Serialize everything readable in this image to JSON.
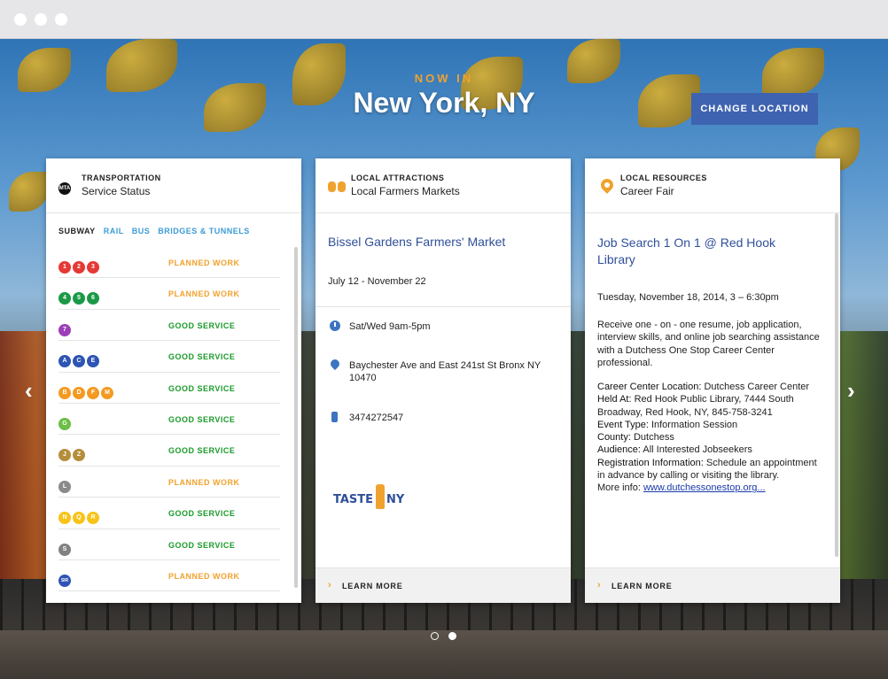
{
  "hero": {
    "now_in": "NOW IN",
    "city": "New York, NY",
    "change_location": "CHANGE LOCATION"
  },
  "transport": {
    "kicker": "TRANSPORTATION",
    "title": "Service Status",
    "icon": "mta-logo-icon",
    "icon_text": "MTA",
    "tabs": [
      "SUBWAY",
      "RAIL",
      "BUS",
      "BRIDGES & TUNNELS"
    ],
    "lines": [
      {
        "bullets": [
          {
            "label": "1",
            "color": "#e53935"
          },
          {
            "label": "2",
            "color": "#e53935"
          },
          {
            "label": "3",
            "color": "#e53935"
          }
        ],
        "status": "PLANNED WORK",
        "status_color": "#f0a22e"
      },
      {
        "bullets": [
          {
            "label": "4",
            "color": "#1a9a47"
          },
          {
            "label": "5",
            "color": "#1a9a47"
          },
          {
            "label": "6",
            "color": "#1a9a47"
          }
        ],
        "status": "PLANNED WORK",
        "status_color": "#f0a22e"
      },
      {
        "bullets": [
          {
            "label": "7",
            "color": "#9c3fb8"
          }
        ],
        "status": "GOOD SERVICE",
        "status_color": "#1a9a2a"
      },
      {
        "bullets": [
          {
            "label": "A",
            "color": "#2e55b5"
          },
          {
            "label": "C",
            "color": "#2e55b5"
          },
          {
            "label": "E",
            "color": "#2e55b5"
          }
        ],
        "status": "GOOD SERVICE",
        "status_color": "#1a9a2a"
      },
      {
        "bullets": [
          {
            "label": "B",
            "color": "#f49a21"
          },
          {
            "label": "D",
            "color": "#f49a21"
          },
          {
            "label": "F",
            "color": "#f49a21"
          },
          {
            "label": "M",
            "color": "#f49a21"
          }
        ],
        "status": "GOOD SERVICE",
        "status_color": "#1a9a2a"
      },
      {
        "bullets": [
          {
            "label": "G",
            "color": "#6cbe45"
          }
        ],
        "status": "GOOD SERVICE",
        "status_color": "#1a9a2a"
      },
      {
        "bullets": [
          {
            "label": "J",
            "color": "#b58d3c"
          },
          {
            "label": "Z",
            "color": "#b58d3c"
          }
        ],
        "status": "GOOD SERVICE",
        "status_color": "#1a9a2a"
      },
      {
        "bullets": [
          {
            "label": "L",
            "color": "#8a8a8a"
          }
        ],
        "status": "PLANNED WORK",
        "status_color": "#f0a22e"
      },
      {
        "bullets": [
          {
            "label": "N",
            "color": "#f8c318"
          },
          {
            "label": "Q",
            "color": "#f8c318"
          },
          {
            "label": "R",
            "color": "#f8c318"
          }
        ],
        "status": "GOOD SERVICE",
        "status_color": "#1a9a2a"
      },
      {
        "bullets": [
          {
            "label": "S",
            "color": "#808183"
          }
        ],
        "status": "GOOD SERVICE",
        "status_color": "#1a9a2a"
      },
      {
        "bullets": [
          {
            "label": "SIR",
            "color": "#2e55b5"
          }
        ],
        "status": "PLANNED WORK",
        "status_color": "#f0a22e"
      }
    ]
  },
  "attractions": {
    "kicker": "LOCAL ATTRACTIONS",
    "title": "Local Farmers Markets",
    "icon": "binoculars-icon",
    "name": "Bissel Gardens Farmers' Market",
    "dates": "July 12 - November 22",
    "hours": "Sat/Wed 9am-5pm",
    "address": "Baychester Ave and East 241st St Bronx NY 10470",
    "phone": "3474272547",
    "logo_left": "TASTE",
    "logo_right": "NY",
    "learn_more": "LEARN MORE"
  },
  "resources": {
    "kicker": "LOCAL RESOURCES",
    "title": "Career Fair",
    "icon": "map-pin-icon",
    "event_title": "Job Search 1 On 1 @ Red Hook Library",
    "date": "Tuesday, November 18, 2014, 3 – 6:30pm",
    "description": "Receive one - on - one resume, job application, interview skills, and online job searching assistance with a Dutchess One Stop Career Center professional.",
    "details": [
      {
        "key": "Career Center Location:",
        "value": " Dutchess Career Center"
      },
      {
        "key": "Held At:",
        "value": " Red Hook Public Library, 7444 South Broadway, Red Hook, NY, 845-758-3241"
      },
      {
        "key": "Event Type:",
        "value": " Information Session"
      },
      {
        "key": "County:",
        "value": " Dutchess"
      },
      {
        "key": "Audience:",
        "value": " All Interested Jobseekers"
      },
      {
        "key": "Registration Information:",
        "value": " Schedule an appointment in advance by calling or visiting the library."
      }
    ],
    "more_info_label": "More info:",
    "more_info_link": "www.dutchessonestop.org...",
    "learn_more": "LEARN MORE"
  },
  "pager": {
    "pages": 2,
    "active": 2
  },
  "nav": {
    "prev": "‹",
    "next": "›"
  }
}
